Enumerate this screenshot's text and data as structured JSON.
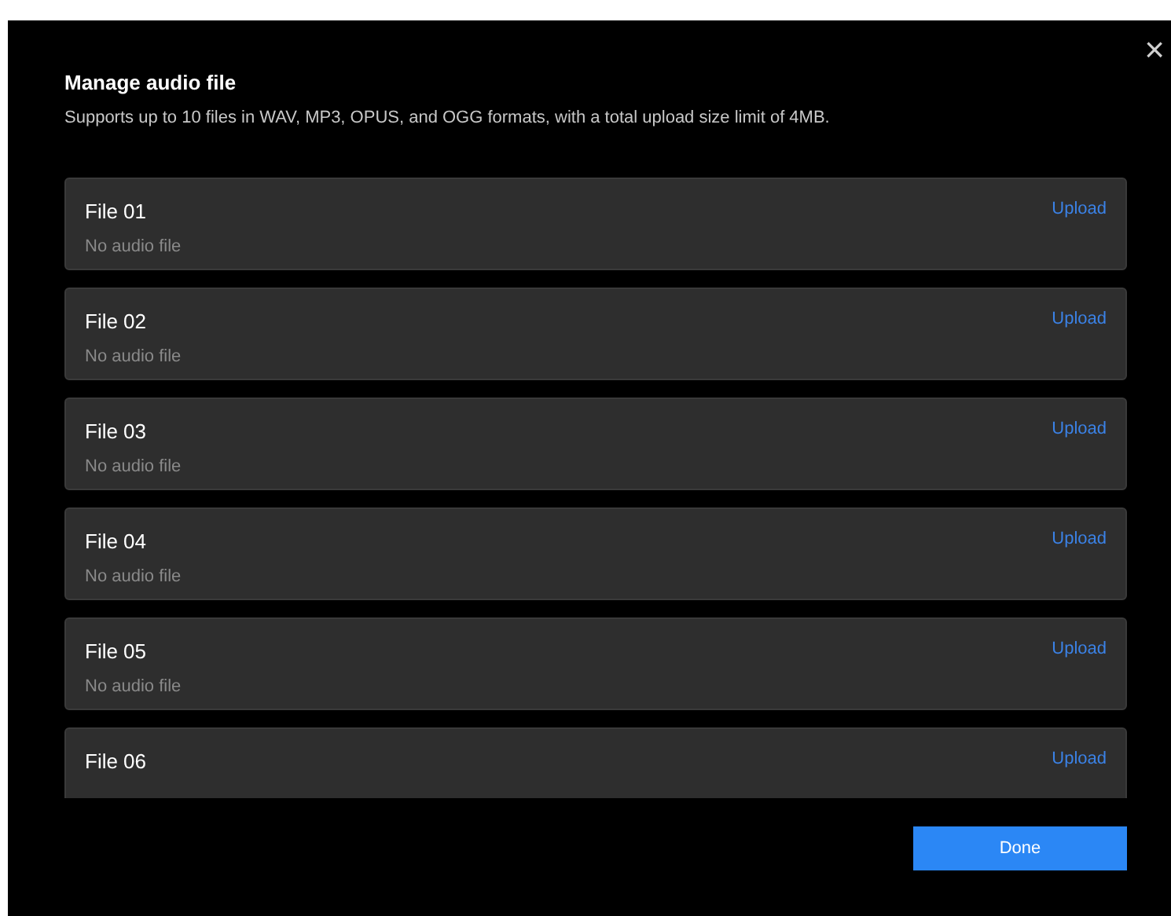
{
  "dialog": {
    "title": "Manage audio file",
    "description": "Supports up to 10 files in WAV, MP3, OPUS, and OGG formats, with a total upload size limit of 4MB.",
    "close": "×"
  },
  "files": [
    {
      "name": "File 01",
      "status": "No audio file",
      "action": "Upload"
    },
    {
      "name": "File 02",
      "status": "No audio file",
      "action": "Upload"
    },
    {
      "name": "File 03",
      "status": "No audio file",
      "action": "Upload"
    },
    {
      "name": "File 04",
      "status": "No audio file",
      "action": "Upload"
    },
    {
      "name": "File 05",
      "status": "No audio file",
      "action": "Upload"
    },
    {
      "name": "File 06",
      "action": "Upload"
    }
  ],
  "buttons": {
    "done": "Done"
  }
}
